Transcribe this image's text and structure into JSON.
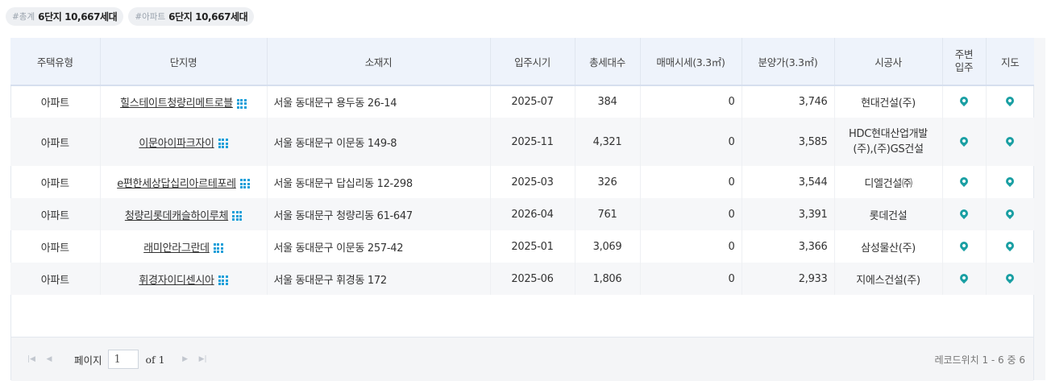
{
  "summary": {
    "total_tag": "#총계",
    "total_value": "6단지 10,667세대",
    "apt_tag": "#아파트",
    "apt_value": "6단지 10,667세대"
  },
  "table": {
    "headers": {
      "type": "주택유형",
      "name": "단지명",
      "location": "소재지",
      "move_in": "입주시기",
      "households": "총세대수",
      "sale_price": "매매시세(3.3㎡)",
      "presale_price": "분양가(3.3㎡)",
      "builder": "시공사",
      "nearby_line1": "주변",
      "nearby_line2": "입주",
      "map": "지도"
    },
    "rows": [
      {
        "type": "아파트",
        "name": "힐스테이트청량리메트로블",
        "location": "서울 동대문구 용두동 26-14",
        "move_in": "2025-07",
        "households": "384",
        "sale_price": "0",
        "presale_price": "3,746",
        "builder": "현대건설(주)"
      },
      {
        "type": "아파트",
        "name": "이문아이파크자이",
        "location": "서울 동대문구 이문동 149-8",
        "move_in": "2025-11",
        "households": "4,321",
        "sale_price": "0",
        "presale_price": "3,585",
        "builder": "HDC현대산업개발(주),(주)GS건설"
      },
      {
        "type": "아파트",
        "name": "e편한세상답십리아르테포레",
        "location": "서울 동대문구 답십리동 12-298",
        "move_in": "2025-03",
        "households": "326",
        "sale_price": "0",
        "presale_price": "3,544",
        "builder": "디엘건설㈜"
      },
      {
        "type": "아파트",
        "name": "청량리롯데캐슬하이루체",
        "location": "서울 동대문구 청량리동 61-647",
        "move_in": "2026-04",
        "households": "761",
        "sale_price": "0",
        "presale_price": "3,391",
        "builder": "롯데건설"
      },
      {
        "type": "아파트",
        "name": "래미안라그란데",
        "location": "서울 동대문구 이문동 257-42",
        "move_in": "2025-01",
        "households": "3,069",
        "sale_price": "0",
        "presale_price": "3,366",
        "builder": "삼성물산(주)"
      },
      {
        "type": "아파트",
        "name": "휘경자이디센시아",
        "location": "서울 동대문구 휘경동 172",
        "move_in": "2025-06",
        "households": "1,806",
        "sale_price": "0",
        "presale_price": "2,933",
        "builder": "지에스건설(주)"
      }
    ]
  },
  "pager": {
    "page_label": "페이지",
    "page_value": "1",
    "of_label": "of 1",
    "record_info": "레코드위치 1 - 6 중 6"
  },
  "colors": {
    "accent": "#1a9fd9",
    "pin": "#1a9fa3",
    "header_bg": "#eef3fb"
  },
  "icons": {
    "complex_detail": "grid-dots-icon",
    "nearby": "map-pin-icon",
    "map": "map-pin-icon"
  }
}
